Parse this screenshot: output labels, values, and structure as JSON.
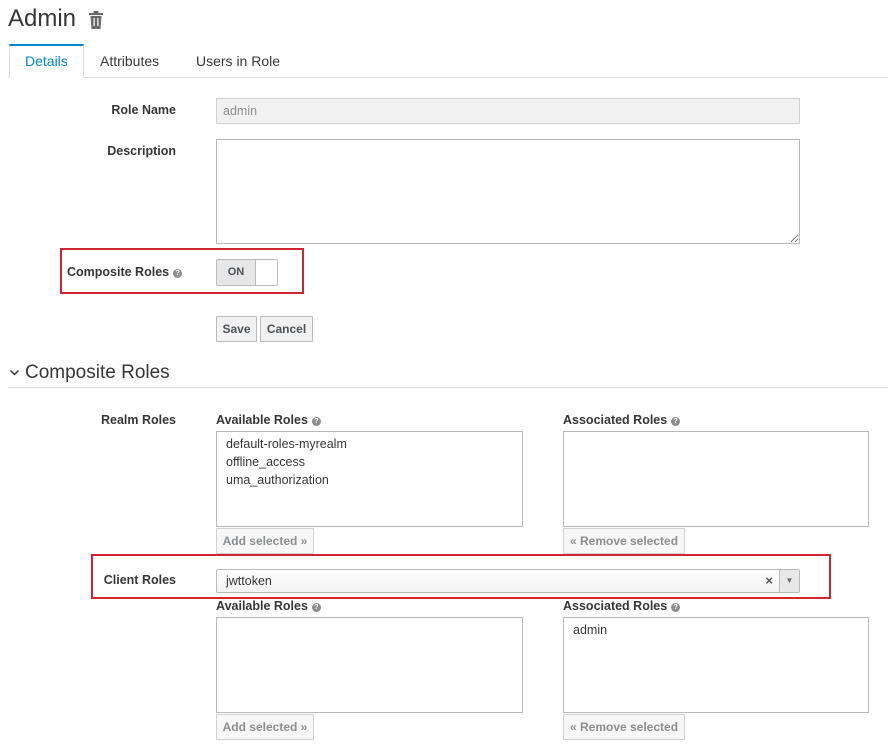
{
  "header": {
    "title": "Admin",
    "delete_icon": "trash-icon"
  },
  "tabs": [
    {
      "label": "Details",
      "active": true
    },
    {
      "label": "Attributes",
      "active": false
    },
    {
      "label": "Users in Role",
      "active": false
    }
  ],
  "form": {
    "role_name": {
      "label": "Role Name",
      "value": "admin"
    },
    "description": {
      "label": "Description",
      "value": ""
    },
    "composite": {
      "label": "Composite Roles",
      "help_icon": "question-circle-icon",
      "toggle_label": "ON",
      "enabled": true
    },
    "save_label": "Save",
    "cancel_label": "Cancel"
  },
  "composite_section": {
    "title": "Composite Roles",
    "realm": {
      "label": "Realm Roles",
      "available_label": "Available Roles",
      "associated_label": "Associated Roles",
      "available": [
        "default-roles-myrealm",
        "offline_access",
        "uma_authorization"
      ],
      "associated": [],
      "add_label": "Add selected »",
      "remove_label": "« Remove selected"
    },
    "client": {
      "label": "Client Roles",
      "selected_client": "jwttoken",
      "clear_symbol": "×",
      "arrow_symbol": "▼",
      "available_label": "Available Roles",
      "associated_label": "Associated Roles",
      "available": [],
      "associated": [
        "admin"
      ],
      "add_label": "Add selected »",
      "remove_label": "« Remove selected"
    }
  },
  "colors": {
    "accent": "#0088ce",
    "highlight": "#d1242f"
  }
}
